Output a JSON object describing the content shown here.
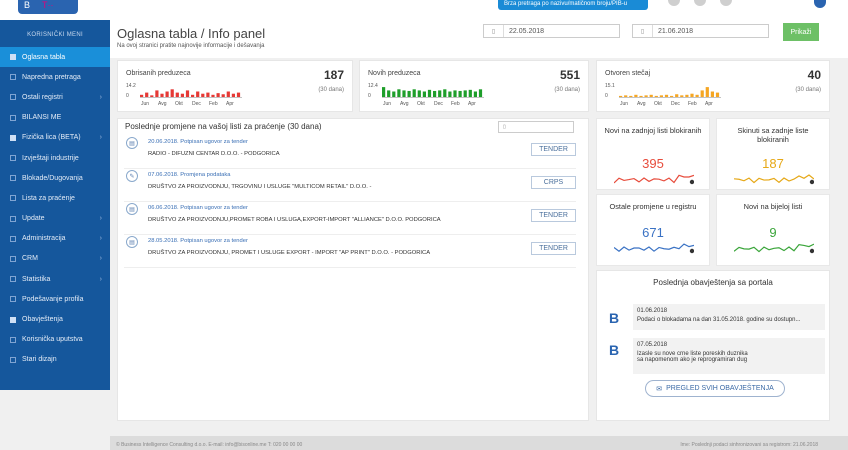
{
  "sidebar": {
    "title": "KORISNIČKI MENI",
    "items": [
      {
        "label": "Oglasna tabla",
        "icon": "monitor-icon",
        "active": true,
        "chevron": false
      },
      {
        "label": "Napredna pretraga",
        "icon": "square-icon",
        "active": false,
        "chevron": false
      },
      {
        "label": "Ostali registri",
        "icon": "square-icon",
        "active": false,
        "chevron": true
      },
      {
        "label": "BILANSI ME",
        "icon": "square-icon",
        "active": false,
        "chevron": false
      },
      {
        "label": "Fizička lica (BETA)",
        "icon": "users-icon",
        "active": false,
        "chevron": true
      },
      {
        "label": "Izvještaji industrije",
        "icon": "square-icon",
        "active": false,
        "chevron": false
      },
      {
        "label": "Blokade/Dugovanja",
        "icon": "square-icon",
        "active": false,
        "chevron": false
      },
      {
        "label": "Lista za praćenje",
        "icon": "square-icon",
        "active": false,
        "chevron": false
      },
      {
        "label": "Update",
        "icon": "square-icon",
        "active": false,
        "chevron": true
      },
      {
        "label": "Administracija",
        "icon": "square-icon",
        "active": false,
        "chevron": true
      },
      {
        "label": "CRM",
        "icon": "square-icon",
        "active": false,
        "chevron": true
      },
      {
        "label": "Statistika",
        "icon": "square-icon",
        "active": false,
        "chevron": true
      },
      {
        "label": "Podešavanje profila",
        "icon": "square-icon",
        "active": false,
        "chevron": false
      },
      {
        "label": "Obavještenja",
        "icon": "envelope-icon",
        "active": false,
        "chevron": false
      },
      {
        "label": "Korisnička uputstva",
        "icon": "square-icon",
        "active": false,
        "chevron": false
      },
      {
        "label": "Stari dizajn",
        "icon": "square-icon",
        "active": false,
        "chevron": false
      }
    ]
  },
  "header": {
    "title": "Oglasna tabla / Info panel",
    "subtitle": "Na ovoj stranici pratite najnovije informacije i dešavanja",
    "date_from": "22.05.2018",
    "date_to": "21.06.2018",
    "show_button": "Prikaži",
    "search_placeholder": "Brza pretraga po nazivu/matičnom broju/PIB-u"
  },
  "stats": [
    {
      "title": "Obrisanih preduzeca",
      "value": "187",
      "period": "(30 dana)",
      "ymax": "14.2",
      "ymin": "0",
      "color": "#e53935",
      "months": [
        "Jun",
        "Avg",
        "Okt",
        "Dec",
        "Feb",
        "Apr"
      ],
      "bars": [
        0.2,
        0.4,
        0.15,
        0.6,
        0.3,
        0.5,
        0.7,
        0.4,
        0.3,
        0.6,
        0.2,
        0.5,
        0.3,
        0.4,
        0.2,
        0.35,
        0.25,
        0.5,
        0.3,
        0.4
      ]
    },
    {
      "title": "Novih preduzeca",
      "value": "551",
      "period": "(30 dana)",
      "ymax": "12.4",
      "ymin": "0",
      "color": "#1e9e2a",
      "months": [
        "Jun",
        "Avg",
        "Okt",
        "Dec",
        "Feb",
        "Apr"
      ],
      "bars": [
        0.9,
        0.6,
        0.5,
        0.7,
        0.6,
        0.55,
        0.7,
        0.6,
        0.5,
        0.65,
        0.55,
        0.6,
        0.7,
        0.5,
        0.6,
        0.55,
        0.6,
        0.65,
        0.5,
        0.7
      ]
    },
    {
      "title": "Otvoren stečaj",
      "value": "40",
      "period": "(30 dana)",
      "ymax": "15.1",
      "ymin": "0",
      "color": "#f5a623",
      "months": [
        "Jun",
        "Avg",
        "Okt",
        "Dec",
        "Feb",
        "Apr"
      ],
      "bars": [
        0.1,
        0.15,
        0.1,
        0.2,
        0.1,
        0.15,
        0.2,
        0.1,
        0.15,
        0.2,
        0.1,
        0.25,
        0.15,
        0.2,
        0.3,
        0.2,
        0.6,
        0.9,
        0.5,
        0.4
      ]
    }
  ],
  "watchlist": {
    "title": "Poslednje promjene na vašoj listi za praćenje (30 dana)",
    "search_icon": "search-icon",
    "rows": [
      {
        "meta": "20.06.2018. Potpisan ugovor za tender",
        "name": "RADIO - DIFUZNI CENTAR D.O.O. - PODGORICA",
        "tag": "TENDER",
        "icon": "document-icon"
      },
      {
        "meta": "07.06.2018. Promjena podataka",
        "name": "DRUŠTVO ZA PROIZVODNJU, TRGOVINU I USLUGE \"MULTICOM RETAIL\" D.O.O. -",
        "tag": "CRPS",
        "icon": "pencil-icon"
      },
      {
        "meta": "06.06.2018. Potpisan ugovor za tender",
        "name": "DRUŠTVO ZA PROIZVODNJU,PROMET ROBA I USLUGA,EXPORT-IMPORT \"ALLIANCE\" D.O.O. PODGORICA",
        "tag": "TENDER",
        "icon": "document-icon"
      },
      {
        "meta": "28.05.2018. Potpisan ugovor za tender",
        "name": "DRUŠTVO ZA PROIZVODNJU, PROMET I USLUGE EXPORT - IMPORT \"AP PRINT\" D.O.O. - PODGORICA",
        "tag": "TENDER",
        "icon": "document-icon"
      }
    ]
  },
  "minis": [
    {
      "title": "Novi na zadnjoj listi blokiranih",
      "value": "395",
      "color": "#e74c3c"
    },
    {
      "title": "Skinuti sa zadnje liste blokiranih",
      "value": "187",
      "color": "#e6a817"
    },
    {
      "title": "Ostale promjene u registru",
      "value": "671",
      "color": "#3a72c4"
    },
    {
      "title": "Novi na bijeloj listi",
      "value": "9",
      "color": "#3aa53a"
    }
  ],
  "news": {
    "title": "Poslednja obavještenja sa portala",
    "items": [
      {
        "date": "01.06.2018",
        "text": "Podaci o blokadama na dan 31.05.2018. godine su dostupn..."
      },
      {
        "date": "07.05.2018",
        "text": "Izasle su nove crne liste poreskih duznika",
        "text2": "sa napomenom ako je reprogramiran dug"
      }
    ],
    "button": "PREGLED SVIH OBAVJEŠTENJA"
  },
  "footer": {
    "left": "© Business Intelligence Consulting d.o.o. E-mail: info@bisonline.me T: 020 00 00 00",
    "right": "Ime: Poslednji podaci sinhronizovani sa registrom: 21.06.2018"
  }
}
